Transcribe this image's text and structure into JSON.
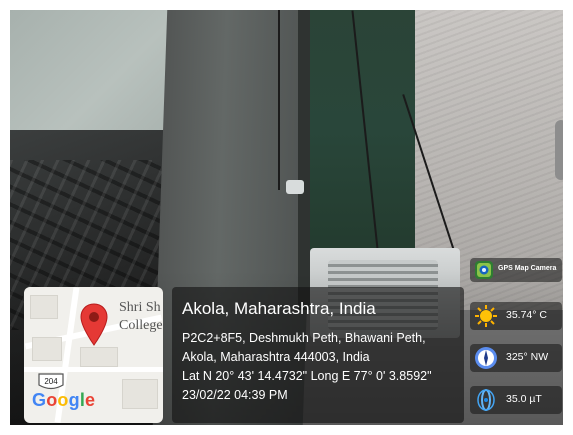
{
  "map": {
    "place_label_line1": "Shri Sh",
    "place_label_line2": "College",
    "road_shield": "204",
    "google_letters": [
      {
        "ch": "G",
        "color": "#4285F4"
      },
      {
        "ch": "o",
        "color": "#EA4335"
      },
      {
        "ch": "o",
        "color": "#FBBC05"
      },
      {
        "ch": "g",
        "color": "#4285F4"
      },
      {
        "ch": "l",
        "color": "#34A853"
      },
      {
        "ch": "e",
        "color": "#EA4335"
      }
    ]
  },
  "location": {
    "title": "Akola, Maharashtra, India",
    "address_line1": "P2C2+8F5, Deshmukh Peth, Bhawani Peth,",
    "address_line2": "Akola, Maharashtra 444003, India",
    "coords": "Lat N 20° 43' 14.4732\" Long E 77° 0' 3.8592\"",
    "datetime": "23/02/22 04:39 PM"
  },
  "widgets": {
    "brand": "GPS Map Camera",
    "temperature": "35.74° C",
    "wind": "325° NW",
    "magnetic": "35.0 µT"
  }
}
